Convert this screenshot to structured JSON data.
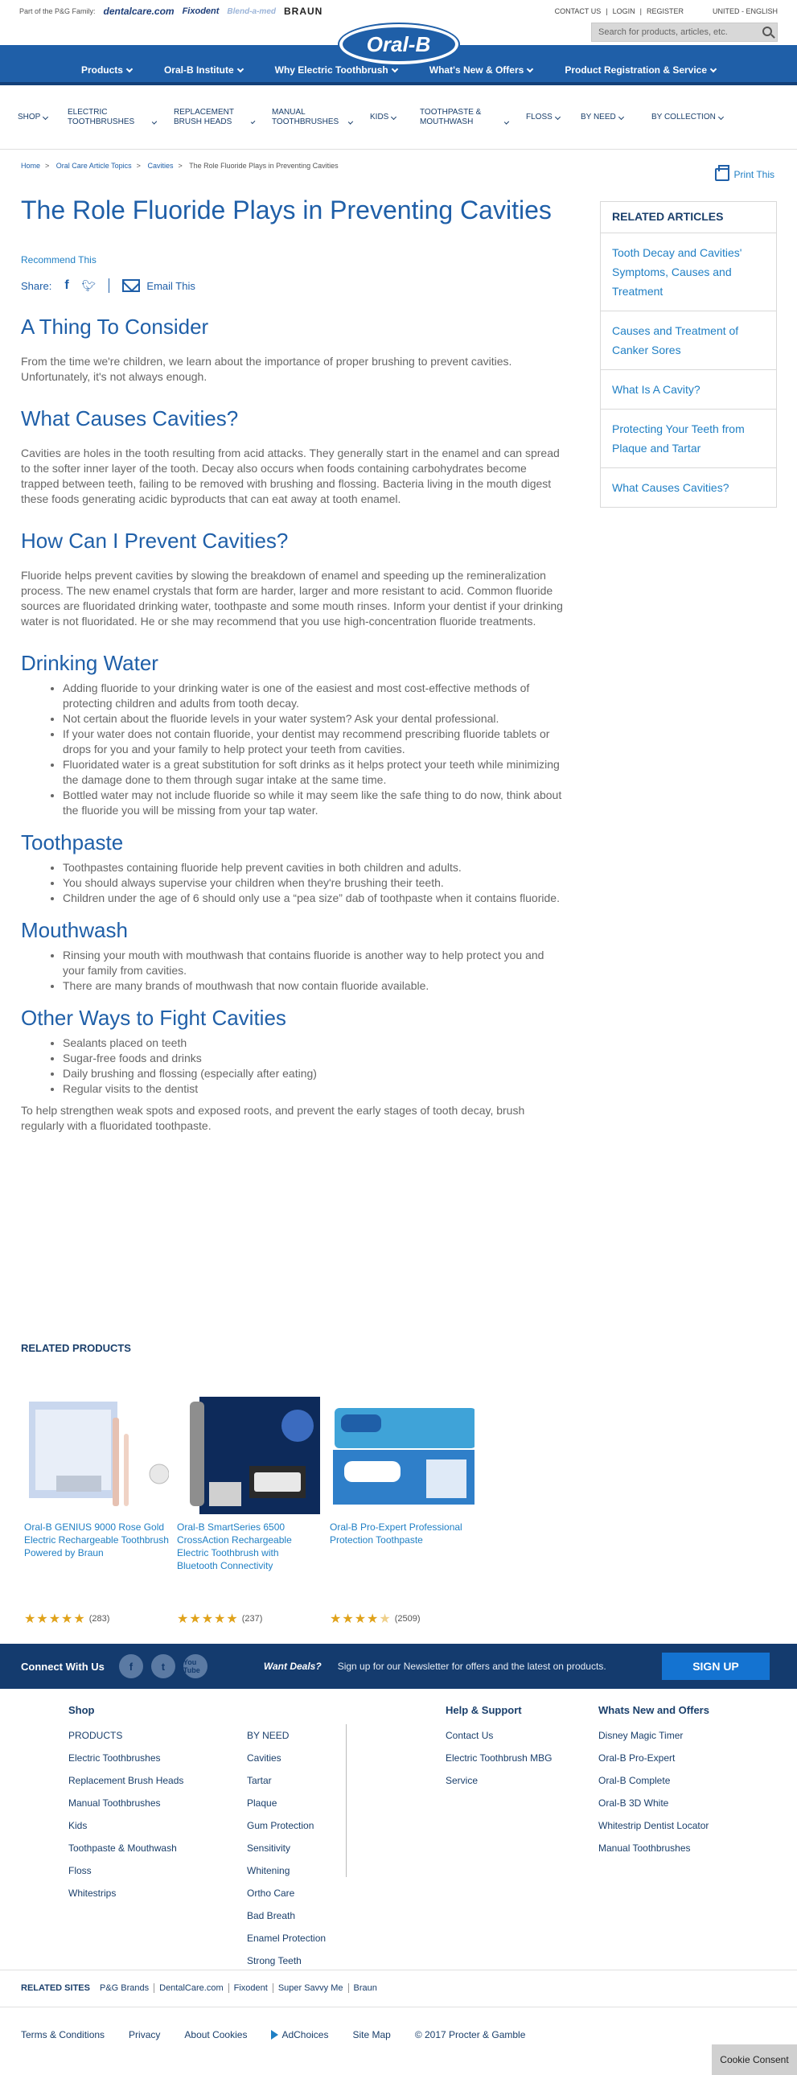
{
  "topbar": {
    "family_label": "Part of the P&G Family:",
    "family_brands": [
      "dentalcare.com",
      "Fixodent",
      "Blend-a-med",
      "BRAUN"
    ],
    "contact": "CONTACT US",
    "login": "LOGIN",
    "register": "REGISTER",
    "region": "UNITED - ENGLISH"
  },
  "search": {
    "placeholder": "Search for products, articles, etc."
  },
  "brand": {
    "logo": "Oral-B"
  },
  "main_nav": [
    {
      "label": "Products"
    },
    {
      "label": "Oral-B Institute"
    },
    {
      "label": "Why Electric Toothbrush"
    },
    {
      "label": "What's New & Offers"
    },
    {
      "label": "Product Registration & Service"
    }
  ],
  "sub_nav": [
    {
      "label": "SHOP"
    },
    {
      "label": "ELECTRIC TOOTHBRUSHES"
    },
    {
      "label": "REPLACEMENT BRUSH HEADS"
    },
    {
      "label": "MANUAL TOOTHBRUSHES"
    },
    {
      "label": "KIDS"
    },
    {
      "label": "TOOTHPASTE & MOUTHWASH"
    },
    {
      "label": "FLOSS"
    },
    {
      "label": "BY NEED"
    },
    {
      "label": "BY COLLECTION"
    }
  ],
  "breadcrumb": [
    "Home",
    "Oral Care Article Topics",
    "Cavities",
    "The Role Fluoride Plays in Preventing Cavities"
  ],
  "print_label": "Print This",
  "article": {
    "title": "The Role Fluoride Plays in Preventing Cavities",
    "recommend": "Recommend This",
    "share_label": "Share:",
    "email_label": "Email This",
    "sections": [
      {
        "heading": "A Thing To Consider",
        "paragraphs": [
          "From the time we're children, we learn about the importance of proper brushing to prevent cavities. Unfortunately, it's not always enough."
        ]
      },
      {
        "heading": "What Causes Cavities?",
        "paragraphs": [
          "Cavities are holes in the tooth resulting from acid attacks. They generally start in the enamel and can spread to the softer inner layer of the tooth. Decay also occurs when foods containing carbohydrates become trapped between teeth, failing to be removed with brushing and flossing. Bacteria living in the mouth digest these foods generating acidic byproducts that can eat away at tooth enamel."
        ]
      },
      {
        "heading": "How Can I Prevent Cavities?",
        "paragraphs": [
          "Fluoride helps prevent cavities by slowing the breakdown of enamel and speeding up the remineralization process. The new enamel crystals that form are harder, larger and more resistant to acid. Common fluoride sources are fluoridated drinking water, toothpaste and some mouth rinses. Inform your dentist if your drinking water is not fluoridated. He or she may recommend that you use high-concentration fluoride treatments."
        ]
      },
      {
        "heading": "Drinking Water",
        "bullets": [
          "Adding fluoride to your drinking water is one of the easiest and most cost-effective methods of protecting children and adults from tooth decay.",
          "Not certain about the fluoride levels in your water system? Ask your dental professional.",
          "If your water does not contain fluoride, your dentist may recommend prescribing fluoride tablets or drops for you and your family to help protect your teeth from cavities.",
          "Fluoridated water is a great substitution for soft drinks as it helps protect your teeth while minimizing the damage done to them through sugar intake at the same time.",
          "Bottled water may not include fluoride so while it may seem like the safe thing to do now, think about the fluoride you will be missing from your tap water."
        ]
      },
      {
        "heading": "Toothpaste",
        "bullets": [
          "Toothpastes containing fluoride help prevent cavities in both children and adults.",
          "You should always supervise your children when they're brushing their teeth.",
          "Children under the age of 6 should only use a “pea size” dab of toothpaste when it contains fluoride."
        ]
      },
      {
        "heading": "Mouthwash",
        "bullets": [
          "Rinsing your mouth with mouthwash that contains fluoride is another way to help protect you and your family from cavities.",
          "There are many brands of mouthwash that now contain fluoride available."
        ]
      },
      {
        "heading": "Other Ways to Fight Cavities",
        "bullets": [
          "Sealants placed on teeth",
          "Sugar-free foods and drinks",
          "Daily brushing and flossing (especially after eating)",
          "Regular visits to the dentist"
        ],
        "closing": "To help strengthen weak spots and exposed roots, and prevent the early stages of tooth decay, brush regularly with a fluoridated toothpaste."
      }
    ]
  },
  "related_articles": {
    "title": "RELATED ARTICLES",
    "items": [
      "Tooth Decay and Cavities' Symptoms, Causes and Treatment",
      "Causes and Treatment of Canker Sores",
      "What Is A Cavity?",
      "Protecting Your Teeth from Plaque and Tartar",
      "What Causes Cavities?"
    ]
  },
  "related_products": {
    "title": "RELATED PRODUCTS",
    "items": [
      {
        "name": "Oral-B GENIUS 9000 Rose Gold Electric Rechargeable Toothbrush Powered by Braun",
        "stars": 5,
        "reviews": "(283)"
      },
      {
        "name": "Oral-B SmartSeries 6500 CrossAction Rechargeable Electric Toothbrush with Bluetooth Connectivity",
        "stars": 5,
        "reviews": "(237)"
      },
      {
        "name": "Oral-B Pro-Expert Professional Protection Toothpaste",
        "stars": 4.5,
        "reviews": "(2509)"
      }
    ]
  },
  "connect": {
    "title": "Connect With Us",
    "socials": [
      "facebook-icon",
      "twitter-icon",
      "youtube-icon"
    ],
    "youtube_label": "You Tube",
    "deals": "Want Deals?",
    "newsletter": "Sign up for our Newsletter for offers and the latest on products.",
    "signup": "SIGN UP"
  },
  "footer": {
    "shop": {
      "title": "Shop",
      "items": [
        "PRODUCTS",
        "Electric Toothbrushes",
        "Replacement Brush Heads",
        "Manual Toothbrushes",
        "Kids",
        "Toothpaste & Mouthwash",
        "Floss",
        "Whitestrips"
      ]
    },
    "byneed": {
      "items": [
        "BY NEED",
        "Cavities",
        "Tartar",
        "Plaque",
        "Gum Protection",
        "Sensitivity",
        "Whitening",
        "Ortho Care",
        "Bad Breath",
        "Enamel Protection",
        "Strong Teeth"
      ]
    },
    "help": {
      "title": "Help & Support",
      "items": [
        "Contact Us",
        "Electric Toothbrush MBG",
        "Service"
      ]
    },
    "whatsnew": {
      "title": "Whats New and Offers",
      "items": [
        "Disney Magic Timer",
        "Oral-B Pro-Expert",
        "Oral-B Complete",
        "Oral-B 3D White",
        "Whitestrip Dentist Locator",
        "Manual Toothbrushes"
      ]
    },
    "related_sites_label": "RELATED SITES",
    "related_sites": [
      "P&G Brands",
      "DentalCare.com",
      "Fixodent",
      "Super Savvy Me",
      "Braun"
    ],
    "legal": [
      "Terms & Conditions",
      "Privacy",
      "About Cookies",
      "AdChoices",
      "Site Map",
      "© 2017 Procter & Gamble"
    ],
    "cookie": "Cookie Consent"
  },
  "colors": {
    "brand_blue": "#1f5fa8",
    "dark_navy": "#143b6e",
    "link_blue": "#1f7fc4",
    "star_gold": "#e0a21a"
  }
}
